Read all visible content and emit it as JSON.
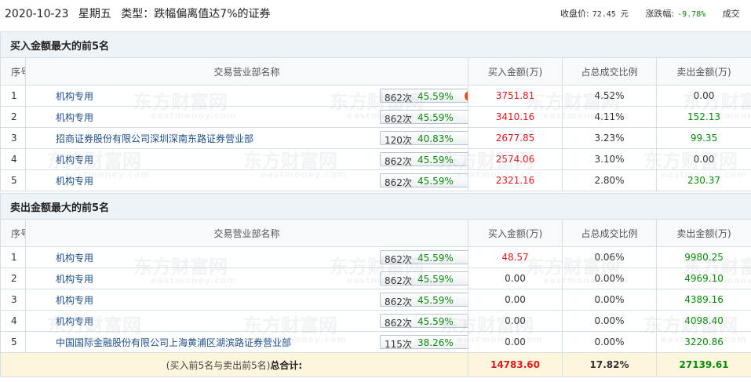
{
  "header": {
    "date": "2020-10-23",
    "weekday": "星期五",
    "type_text": "类型：跌幅偏离值达7%的证券",
    "close_label": "收盘价:",
    "close_value": "72.45 元",
    "change_label": "涨跌幅:",
    "change_value": "-9.78%",
    "trade_label": "成交"
  },
  "columns": {
    "no": "序号",
    "name": "交易营业部名称",
    "buy": "买入金额(万)",
    "ratio": "占总成交比例",
    "sell": "卖出金额(万)"
  },
  "buy_section": {
    "title": "买入金额最大的前5名",
    "rows": [
      {
        "no": "1",
        "name": "机构专用",
        "count": "862次",
        "pct": "45.59%",
        "buy": "3751.81",
        "ratio": "4.52%",
        "sell": "0.00",
        "icon": "question-icon"
      },
      {
        "no": "2",
        "name": "机构专用",
        "count": "862次",
        "pct": "45.59%",
        "buy": "3410.16",
        "ratio": "4.11%",
        "sell": "152.13",
        "icon": "arrow-right-icon"
      },
      {
        "no": "3",
        "name": "招商证券股份有限公司深圳深南东路证券营业部",
        "count": "120次",
        "pct": "40.83%",
        "buy": "2677.85",
        "ratio": "3.23%",
        "sell": "99.35",
        "icon": "arrow-right-icon"
      },
      {
        "no": "4",
        "name": "机构专用",
        "count": "862次",
        "pct": "45.59%",
        "buy": "2574.06",
        "ratio": "3.10%",
        "sell": "0.00",
        "icon": "arrow-right-icon"
      },
      {
        "no": "5",
        "name": "机构专用",
        "count": "862次",
        "pct": "45.59%",
        "buy": "2321.16",
        "ratio": "2.80%",
        "sell": "230.37",
        "icon": "arrow-right-icon"
      }
    ]
  },
  "sell_section": {
    "title": "卖出金额最大的前5名",
    "rows": [
      {
        "no": "1",
        "name": "机构专用",
        "count": "862次",
        "pct": "45.59%",
        "buy": "48.57",
        "ratio": "0.06%",
        "sell": "9980.25",
        "icon": "arrow-right-icon"
      },
      {
        "no": "2",
        "name": "机构专用",
        "count": "862次",
        "pct": "45.59%",
        "buy": "0.00",
        "ratio": "0.00%",
        "sell": "4969.10",
        "icon": "arrow-right-icon"
      },
      {
        "no": "3",
        "name": "机构专用",
        "count": "862次",
        "pct": "45.59%",
        "buy": "0.00",
        "ratio": "0.00%",
        "sell": "4389.16",
        "icon": "arrow-right-icon"
      },
      {
        "no": "4",
        "name": "机构专用",
        "count": "862次",
        "pct": "45.59%",
        "buy": "0.00",
        "ratio": "0.00%",
        "sell": "4098.40",
        "icon": "arrow-right-icon"
      },
      {
        "no": "5",
        "name": "中国国际金融股份有限公司上海黄浦区湖滨路证券营业部",
        "count": "115次",
        "pct": "38.26%",
        "buy": "0.00",
        "ratio": "0.00%",
        "sell": "3220.86",
        "icon": "arrow-right-icon"
      }
    ]
  },
  "total": {
    "label_prefix": "(买入前5名与卖出前5名)",
    "label_bold": "总合计:",
    "buy": "14783.60",
    "ratio": "17.82%",
    "sell": "27139.61"
  },
  "watermark": {
    "cn": "东方财富网",
    "en": "eastmoney.com"
  },
  "colors": {
    "buy_red": "#e0191e",
    "sell_green": "#0a8a0a",
    "link_blue": "#1d4e89",
    "section_bg": "#eef3f8",
    "total_bg": "#fdf5dc"
  }
}
